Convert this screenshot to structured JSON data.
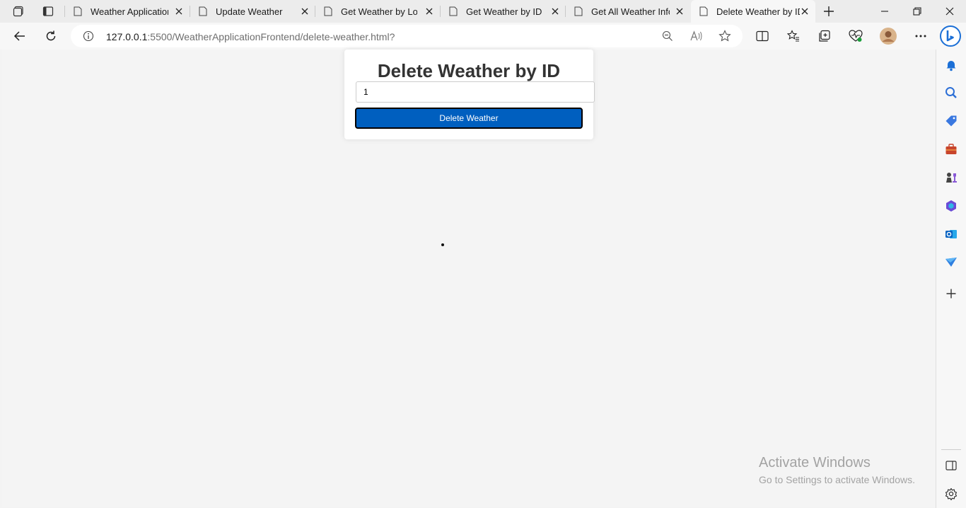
{
  "browser": {
    "tabs": [
      {
        "label": "Weather Application"
      },
      {
        "label": "Update Weather"
      },
      {
        "label": "Get Weather by Location"
      },
      {
        "label": "Get Weather by ID"
      },
      {
        "label": "Get All Weather Information"
      },
      {
        "label": "Delete Weather by ID",
        "active": true
      }
    ],
    "address": {
      "host": "127.0.0.1",
      "path": ":5500/WeatherApplicationFrontend/delete-weather.html?"
    }
  },
  "page": {
    "heading": "Delete Weather by ID",
    "id_input_value": "1",
    "delete_button_label": "Delete Weather"
  },
  "watermark": {
    "line1": "Activate Windows",
    "line2": "Go to Settings to activate Windows."
  },
  "colors": {
    "button_bg": "#005fbf",
    "button_border": "#000000",
    "heading": "#333333",
    "page_bg": "#f4f4f4"
  },
  "icons": {
    "tab_actions": "tab-actions-icon",
    "vertical_tabs": "vertical-tabs-icon",
    "tab_page": "page-icon",
    "tab_close": "close-icon",
    "new_tab": "plus-icon",
    "back": "back-arrow-icon",
    "refresh": "refresh-icon",
    "site_info": "info-icon"
  }
}
